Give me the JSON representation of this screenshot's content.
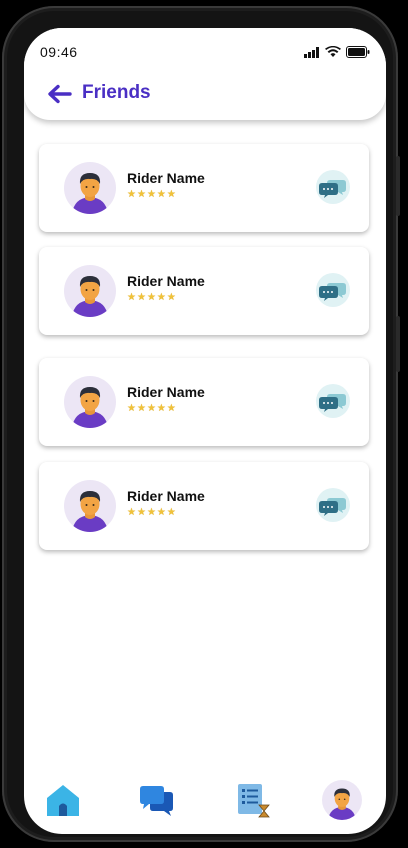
{
  "status_bar": {
    "time": "09:46"
  },
  "header": {
    "title": "Friends"
  },
  "friends": [
    {
      "name": "Rider Name",
      "rating": 5
    },
    {
      "name": "Rider Name",
      "rating": 5
    },
    {
      "name": "Rider Name",
      "rating": 5
    },
    {
      "name": "Rider Name",
      "rating": 5
    }
  ],
  "stars_glyph": "★★★★★",
  "icons": {
    "back": "arrow-left-icon",
    "chat": "chat-bubble-icon",
    "nav": [
      "home-icon",
      "messages-icon",
      "history-icon",
      "profile-avatar"
    ]
  },
  "colors": {
    "accent": "#4a2fc4",
    "star": "#f0c23a",
    "chat_bg": "#e0f2f4",
    "nav_home": "#3bb4e6",
    "nav_chat": "#2479d6"
  }
}
